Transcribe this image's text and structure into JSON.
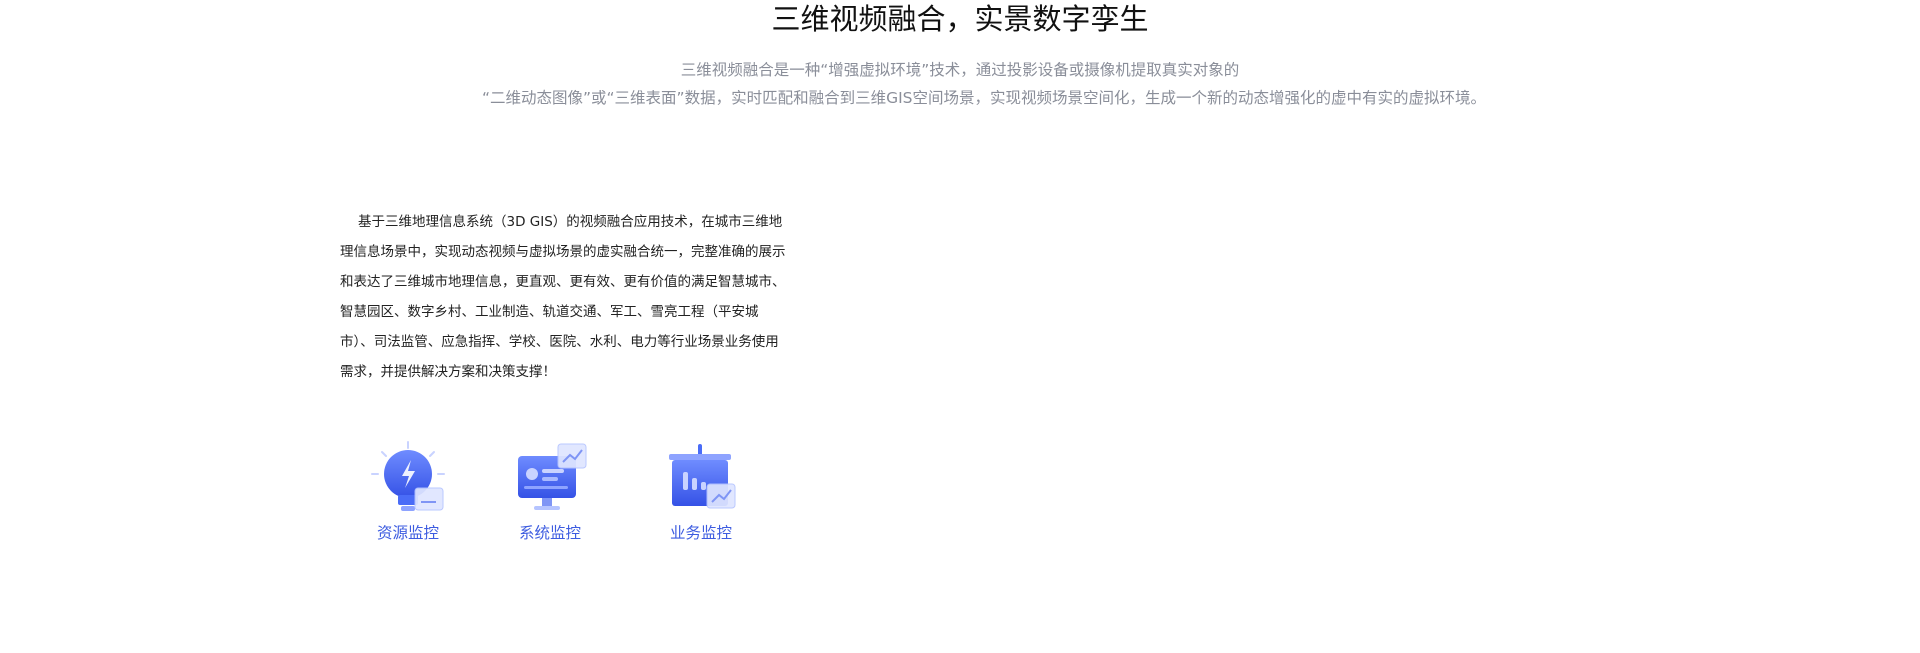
{
  "header": {
    "title": "三维视频融合，实景数字孪生",
    "subtitle_line1": "三维视频融合是一种“增强虚拟环境”技术，通过投影设备或摄像机提取真实对象的",
    "subtitle_line2": "“二维动态图像”或“三维表面”数据，实时匹配和融合到三维GIS空间场景，实现视频场景空间化，生成一个新的动态增强化的虚中有实的虚拟环境。"
  },
  "main": {
    "description": "基于三维地理信息系统（3D GIS）的视频融合应用技术，在城市三维地理信息场景中，实现动态视频与虚拟场景的虚实融合统一，完整准确的展示和表达了三维城市地理信息，更直观、更有效、更有价值的满足智慧城市、智慧园区、数字乡村、工业制造、轨道交通、军工、雪亮工程（平安城市）、司法监管、应急指挥、学校、医院、水利、电力等行业场景业务使用需求，并提供解决方案和决策支撑！"
  },
  "monitors": [
    {
      "label": "资源监控",
      "icon": "lightbulb-icon"
    },
    {
      "label": "系统监控",
      "icon": "monitor-screen-icon"
    },
    {
      "label": "业务监控",
      "icon": "presentation-board-icon"
    }
  ],
  "colors": {
    "accent": "#3d5ce0",
    "icon_primary": "#4a6cf7",
    "subtitle": "#8a8e99"
  }
}
